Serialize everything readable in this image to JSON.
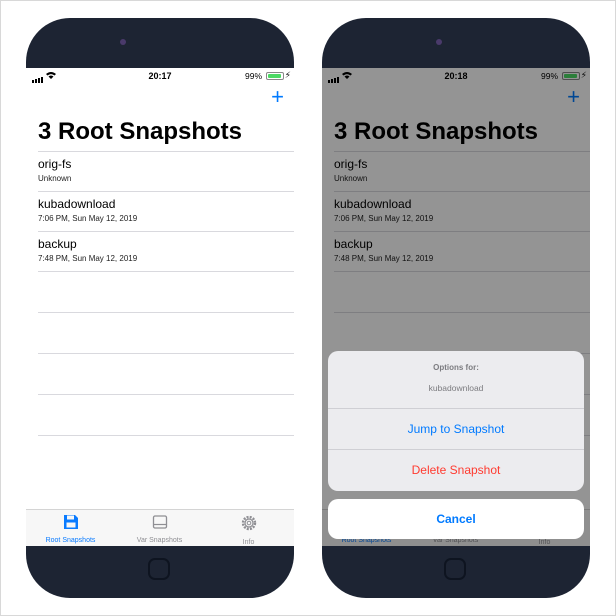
{
  "phones": [
    {
      "status": {
        "time": "20:17",
        "battery": "99%"
      },
      "add_symbol": "+",
      "title": "3 Root Snapshots",
      "snapshots": [
        {
          "name": "orig-fs",
          "date": "Unknown"
        },
        {
          "name": "kubadownload",
          "date": "7:06 PM, Sun May 12, 2019"
        },
        {
          "name": "backup",
          "date": "7:48 PM, Sun May 12, 2019"
        }
      ],
      "tabs": [
        {
          "label": "Root Snapshots",
          "icon": "floppy-disk-icon"
        },
        {
          "label": "Var Snapshots",
          "icon": "drive-icon"
        },
        {
          "label": "Info",
          "icon": "gear-icon"
        }
      ]
    },
    {
      "status": {
        "time": "20:18",
        "battery": "99%"
      },
      "add_symbol": "+",
      "title": "3 Root Snapshots",
      "snapshots": [
        {
          "name": "orig-fs",
          "date": "Unknown"
        },
        {
          "name": "kubadownload",
          "date": "7:06 PM, Sun May 12, 2019"
        },
        {
          "name": "backup",
          "date": "7:48 PM, Sun May 12, 2019"
        }
      ],
      "tabs": [
        {
          "label": "Root Snapshots",
          "icon": "floppy-disk-icon"
        },
        {
          "label": "Var Snapshots",
          "icon": "drive-icon"
        },
        {
          "label": "Info",
          "icon": "gear-icon"
        }
      ],
      "action_sheet": {
        "title": "Options for:",
        "message": "kubadownload",
        "jump": "Jump to Snapshot",
        "delete": "Delete Snapshot",
        "cancel": "Cancel"
      }
    }
  ],
  "colors": {
    "accent": "#007aff",
    "destructive": "#ff3b30",
    "phone_body": "#1d2433",
    "battery": "#4cd964"
  }
}
